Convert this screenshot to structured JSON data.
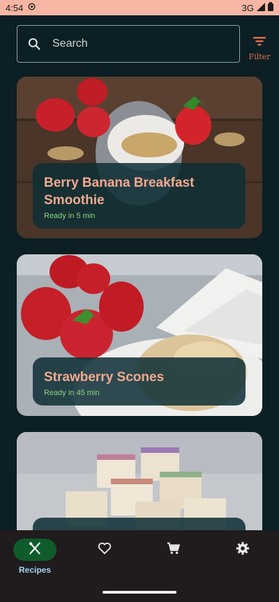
{
  "status_bar": {
    "time": "4:54",
    "network": "3G"
  },
  "search": {
    "placeholder": "Search"
  },
  "filter": {
    "label": "Filter"
  },
  "recipes": [
    {
      "title": "Berry Banana Breakfast Smoothie",
      "ready": "Ready in 5 min"
    },
    {
      "title": "Strawberry Scones",
      "ready": "Ready in 45 min"
    },
    {
      "title": "",
      "ready": ""
    }
  ],
  "nav": {
    "items": [
      {
        "label": "Recipes",
        "icon": "cutlery-icon",
        "active": true
      },
      {
        "label": "",
        "icon": "heart-icon",
        "active": false
      },
      {
        "label": "",
        "icon": "cart-icon",
        "active": false
      },
      {
        "label": "",
        "icon": "gear-icon",
        "active": false
      }
    ]
  },
  "colors": {
    "background": "#0c1f25",
    "status_bar": "#f7b6a3",
    "title_accent": "#f2a98f",
    "subtitle_green": "#8fd27c",
    "nav_active_pill": "#0f5b2b",
    "nav_label": "#9fd6ee"
  }
}
